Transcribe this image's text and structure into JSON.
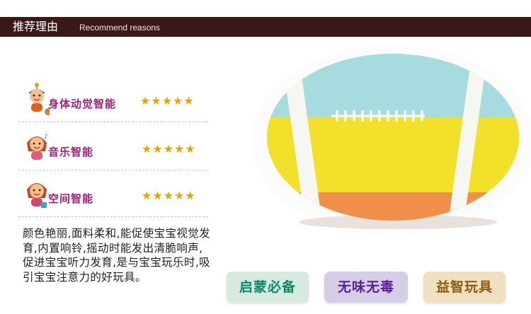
{
  "header": {
    "title_cn": "推荐理由",
    "title_en": "Recommend reasons"
  },
  "features": [
    {
      "label": "身体动觉智能",
      "stars": "★★★★★",
      "rating": 5,
      "color": "#a2207a"
    },
    {
      "label": "音乐智能",
      "stars": "★★★★★",
      "rating": 5,
      "color": "#a2207a"
    },
    {
      "label": "空间智能",
      "stars": "★★★★★",
      "rating": 5,
      "color": "#a2207a"
    }
  ],
  "description": "颜色艳丽,面料柔和,能促使宝宝视觉发育,内置响铃,摇动时能发出清脆响声,促进宝宝听力发育,是与宝宝玩乐时,吸引宝宝注意力的好玩具。",
  "badges": [
    {
      "label": "启蒙必备",
      "bg": "#d6eadf",
      "text": "#0f8a6a"
    },
    {
      "label": "无味无毒",
      "bg": "#d6cde6",
      "text": "#5a1f97"
    },
    {
      "label": "益智玩具",
      "bg": "#efe0c0",
      "text": "#8a5a12"
    }
  ],
  "product": {
    "name": "plush rugby ball",
    "colors": {
      "top": "#a6dbe0",
      "middle": "#f2e02a",
      "bottom": "#ef8f4a",
      "stripe": "#f7f7f2"
    }
  }
}
